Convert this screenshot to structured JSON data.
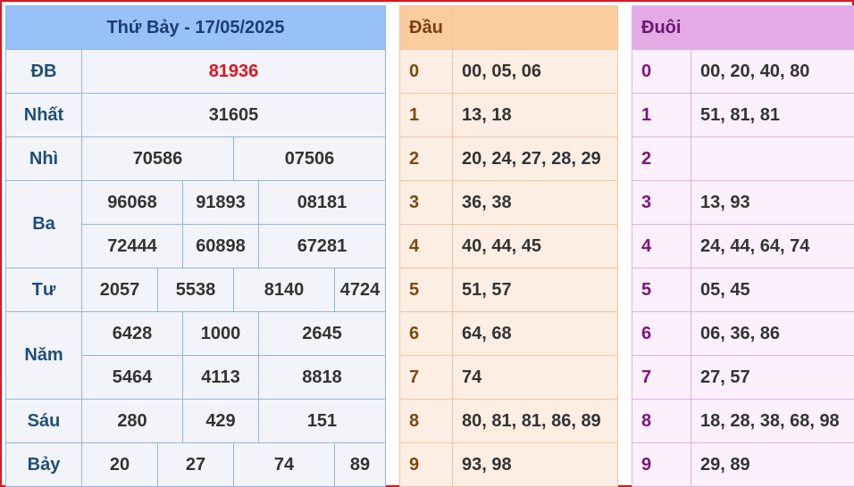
{
  "results": {
    "title": "Thứ Bảy - 17/05/2025",
    "rows": {
      "db": {
        "label": "ĐB",
        "values": [
          "81936"
        ]
      },
      "nhat": {
        "label": "Nhất",
        "values": [
          "31605"
        ]
      },
      "nhi": {
        "label": "Nhì",
        "values": [
          "70586",
          "07506"
        ]
      },
      "ba": {
        "label": "Ba",
        "values": [
          "96068",
          "91893",
          "08181",
          "72444",
          "60898",
          "67281"
        ]
      },
      "tu": {
        "label": "Tư",
        "values": [
          "2057",
          "5538",
          "8140",
          "4724"
        ]
      },
      "nam": {
        "label": "Năm",
        "values": [
          "6428",
          "1000",
          "2645",
          "5464",
          "4113",
          "8818"
        ]
      },
      "sau": {
        "label": "Sáu",
        "values": [
          "280",
          "429",
          "151"
        ]
      },
      "bay": {
        "label": "Bảy",
        "values": [
          "20",
          "27",
          "74",
          "89"
        ]
      }
    },
    "colors": {
      "header_bg": "#98c1f7",
      "special_prize": "#e0141e"
    }
  },
  "dau": {
    "header": "Đầu",
    "rows": [
      {
        "key": "0",
        "values": "00, 05, 06"
      },
      {
        "key": "1",
        "values": "13, 18"
      },
      {
        "key": "2",
        "values": "20, 24, 27, 28, 29"
      },
      {
        "key": "3",
        "values": "36, 38"
      },
      {
        "key": "4",
        "values": "40, 44, 45"
      },
      {
        "key": "5",
        "values": "51, 57"
      },
      {
        "key": "6",
        "values": "64, 68"
      },
      {
        "key": "7",
        "values": "74"
      },
      {
        "key": "8",
        "values": "80, 81, 81, 86, 89"
      },
      {
        "key": "9",
        "values": "93, 98"
      }
    ]
  },
  "duoi": {
    "header": "Đuôi",
    "rows": [
      {
        "key": "0",
        "values": "00, 20, 40, 80"
      },
      {
        "key": "1",
        "values": "51, 81, 81"
      },
      {
        "key": "2",
        "values": ""
      },
      {
        "key": "3",
        "values": "13, 93"
      },
      {
        "key": "4",
        "values": "24, 44, 64, 74"
      },
      {
        "key": "5",
        "values": "05, 45"
      },
      {
        "key": "6",
        "values": "06, 36, 86"
      },
      {
        "key": "7",
        "values": "27, 57"
      },
      {
        "key": "8",
        "values": "18, 28, 38, 68, 98"
      },
      {
        "key": "9",
        "values": "29, 89"
      }
    ]
  }
}
